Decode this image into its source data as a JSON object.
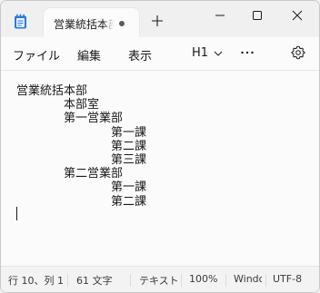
{
  "tab": {
    "title": "営業統括本部"
  },
  "menu": {
    "file": "ファイル",
    "edit": "編集",
    "view": "表示"
  },
  "toolbar": {
    "heading": "H1"
  },
  "editor": {
    "lines": [
      "営業統括本部",
      "　　　　本部室",
      "　　　　第一営業部",
      "　　　　　　　　第一課",
      "　　　　　　　　第二課",
      "　　　　　　　　第三課",
      "　　　　第二営業部",
      "　　　　　　　　第一課",
      "　　　　　　　　第二課",
      ""
    ]
  },
  "status": {
    "position": "行 10、列 1",
    "characters": "61 文字",
    "format": "テキスト",
    "zoom": "100%",
    "line_ending": "Windows (CRLF)",
    "encoding": "UTF-8"
  },
  "colors": {
    "accent": "#1a73e8",
    "text": "#1a1a1a",
    "background": "#fbfbfb"
  },
  "icons": [
    "notepad-icon",
    "new-tab-icon",
    "minimize-icon",
    "maximize-icon",
    "close-icon",
    "chevron-down-icon",
    "more-icon",
    "gear-icon"
  ]
}
